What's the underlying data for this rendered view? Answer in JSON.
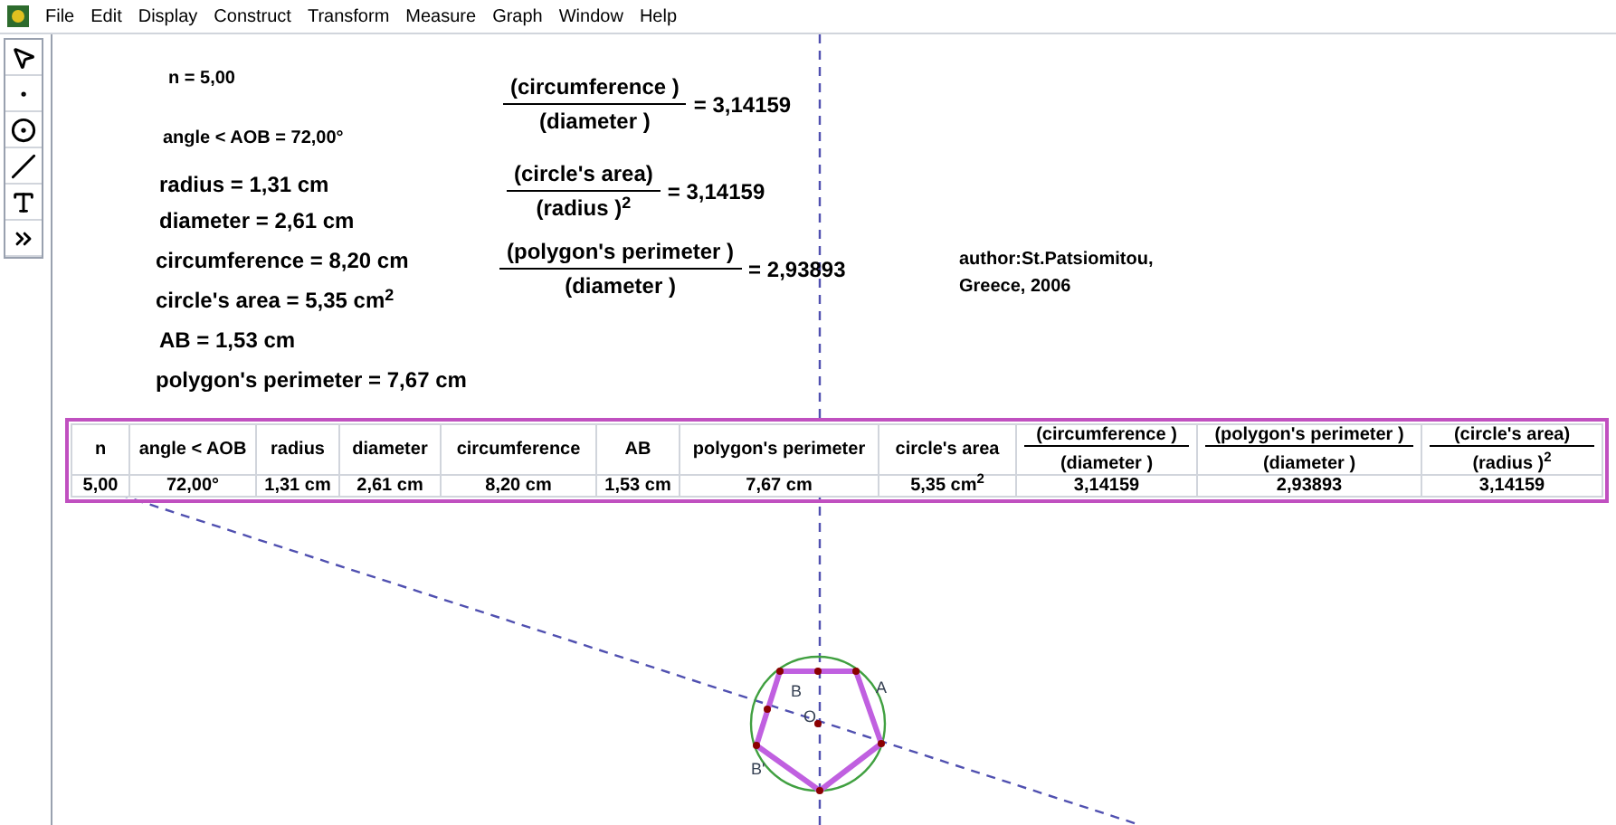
{
  "menu": [
    "File",
    "Edit",
    "Display",
    "Construct",
    "Transform",
    "Measure",
    "Graph",
    "Window",
    "Help"
  ],
  "tools": [
    {
      "kind": "arrow"
    },
    {
      "kind": "point"
    },
    {
      "kind": "compass"
    },
    {
      "kind": "line"
    },
    {
      "kind": "text"
    },
    {
      "kind": "custom"
    }
  ],
  "measurements": [
    {
      "kind": "label",
      "text": "n = 5,00"
    },
    {
      "kind": "label",
      "text": "angle < AOB = 72,00°"
    },
    {
      "kind": "text",
      "text": "radius  = 1,31 cm"
    },
    {
      "kind": "text",
      "text": "diameter  = 2,61 cm"
    },
    {
      "kind": "text",
      "text": "circumference  = 8,20 cm"
    },
    {
      "kind": "text",
      "text": "circle's area = 5,35 cm$^{2}$"
    },
    {
      "kind": "text",
      "text": "AB = 1,53 cm"
    },
    {
      "kind": "text",
      "text": "polygon's perimeter  = 7,67 cm"
    },
    {
      "kind": "fraction",
      "numerator": "(circumference )",
      "denominator": "(diameter )",
      "value": "= 3,14159"
    },
    {
      "kind": "fraction",
      "numerator": "(circle's area)",
      "denominator": "(radius )$^{2}$",
      "value": "= 3,14159"
    },
    {
      "kind": "fraction",
      "numerator": "(polygon's perimeter )",
      "denominator": "(diameter )",
      "value": "= 2,93893"
    }
  ],
  "author": [
    "author:St.Patsiomitou,",
    "Greece, 2006"
  ],
  "table": {
    "columns": [
      {
        "kind": "text",
        "label": "n"
      },
      {
        "kind": "text",
        "label": "angle < AOB"
      },
      {
        "kind": "text",
        "label": "radius"
      },
      {
        "kind": "text",
        "label": "diameter"
      },
      {
        "kind": "text",
        "label": "circumference"
      },
      {
        "kind": "text",
        "label": "AB"
      },
      {
        "kind": "text",
        "label": "polygon's perimeter"
      },
      {
        "kind": "text",
        "label": "circle's area"
      },
      {
        "kind": "fraction",
        "numerator": "(circumference )",
        "denominator": "(diameter )"
      },
      {
        "kind": "fraction",
        "numerator": "(polygon's perimeter )",
        "denominator": "(diameter )"
      },
      {
        "kind": "fraction",
        "numerator": "(circle's area)",
        "denominator": "(radius )$^{2}$"
      }
    ],
    "row": [
      "5,00",
      "72,00°",
      "1,31 cm",
      "2,61 cm",
      "8,20 cm",
      "1,53 cm",
      "7,67 cm",
      "5,35 cm$^{2}$",
      "3,14159",
      "2,93893",
      "3,14159"
    ]
  },
  "points": [
    "B",
    "A",
    "O",
    "B'"
  ]
}
